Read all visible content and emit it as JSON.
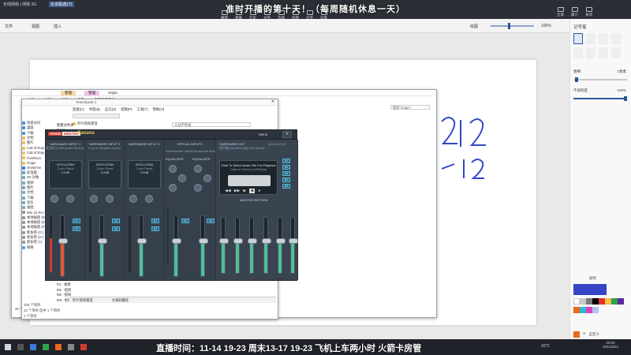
{
  "topbar": {
    "left_text": "无线网络 | 网络 3G",
    "isp": "东京联通17L",
    "banner": "准时开播的第十天！（每周随机休息一天）",
    "tools": [
      "撤销",
      "重做",
      "历史",
      "文件",
      "选择",
      "绘图",
      "文字",
      "设置"
    ],
    "right_tools": [
      "全屏",
      "最小",
      "关闭"
    ]
  },
  "ribbon": {
    "items": [
      "文件",
      "视图",
      "插入",
      "绘图"
    ],
    "zoom": "100%"
  },
  "explorer_back": {
    "tabs": [
      "管理",
      "管理",
      "Origin"
    ],
    "menus": [
      "文件",
      "主页",
      "共享",
      "查看",
      "应用程序工具"
    ],
    "address": "Origin",
    "search_placeholder": "搜索\"Origin\"",
    "status": "25 个项目"
  },
  "explorer_front": {
    "title": "TeamSpeak 3",
    "menus": [
      "连接(C)",
      "书签(B)",
      "自己(S)",
      "权限(P)",
      "工具(T)",
      "帮助(H)"
    ],
    "channel": "叶叶的背景音",
    "channel_right": "大战不熟谁",
    "tabs": [
      "叶叶的背景音",
      "大家好都在"
    ],
    "tree": [
      "快速访问",
      "桌面",
      "下载",
      "文档",
      "图片",
      "Call of Duty",
      "Call of Duty",
      "FiveRecs",
      "Origin",
      "OneDrive",
      "此电脑",
      "3D 对象",
      "视频",
      "图片",
      "文档",
      "下载",
      "音乐",
      "桌面",
      "Win 10 Pro x64",
      "本地磁盘 (D:)",
      "本地磁盘 (E:)",
      "本地磁盘 (F:)",
      "新加卷 (G:)",
      "新加卷 (H:)",
      "新加卷 (I:)",
      "网络"
    ],
    "side_items": [
      "新建文件夹",
      "Origin",
      "1E"
    ],
    "bottom_list": [
      "P1 - 指挥",
      "M1 - 指挥",
      "M2 - 指挥",
      "M3 - 指挥"
    ],
    "status": "225 个项目",
    "status2": "13 个项目 选中 1 个项目",
    "status3": "1 个项目"
  },
  "voicemeeter": {
    "brand1": "VOICE",
    "brand2": "MEETER",
    "brand3": "Banana",
    "window_menu": "Menu",
    "hardware_in": [
      {
        "title": "HARDWARE INPUT 1",
        "device": "麦克风 (USB Audio Device)",
        "label": "INTELLIPAN",
        "sub": "Color Panel",
        "val": "0.0dB"
      },
      {
        "title": "HARDWARE INPUT 2",
        "device": "Line In (Realtek Audio)",
        "label": "INTELLIPAN",
        "sub": "Color Panel",
        "val": "0.0dB"
      },
      {
        "title": "HARDWARE INPUT 3",
        "device": "",
        "label": "INTELLIPAN",
        "sub": "Color Panel",
        "val": "0.0dB"
      }
    ],
    "virtual_title": "VIRTUAL INPUTS",
    "virtual": [
      "Voicemeeter VAIO",
      "Voicemeeter AUX"
    ],
    "equalizer": "EQUALIZER",
    "hw_out_title": "HARDWARE OUT",
    "hw_out_sub": "44.1kHz 512",
    "hw_out_device": "扬声器 (Realtek High Def Audio)",
    "buses": [
      "A1",
      "A2",
      "A3",
      "B1",
      "B2"
    ],
    "tape_msg": "Click To Select Audio File For Playback",
    "tape_sub": "Click to Select (Left/Right)",
    "master": "MASTER SECTION",
    "mute": "Mute",
    "solo": "Solo",
    "mono": "Mono"
  },
  "pen_panel": {
    "title": "记号笔",
    "thickness": "粗细",
    "thickness_val": "1像素",
    "opacity": "不透明度",
    "opacity_val": "100%",
    "color_label": "颜色",
    "custom": "自定义"
  },
  "handwriting": [
    "212",
    "12"
  ],
  "taskbar": {
    "caption": "直播时间：11-14 19-23 周末13-17 19-23 飞机上车两小时 火箭卡房管",
    "temp": "20°C",
    "time": "20:02",
    "date": "2021/8/24"
  },
  "colors": {
    "bg": "#3a3d44",
    "pen_blue": "#3446c7",
    "vm_green": "#4fbf98",
    "vm_red": "#e05a3a"
  }
}
